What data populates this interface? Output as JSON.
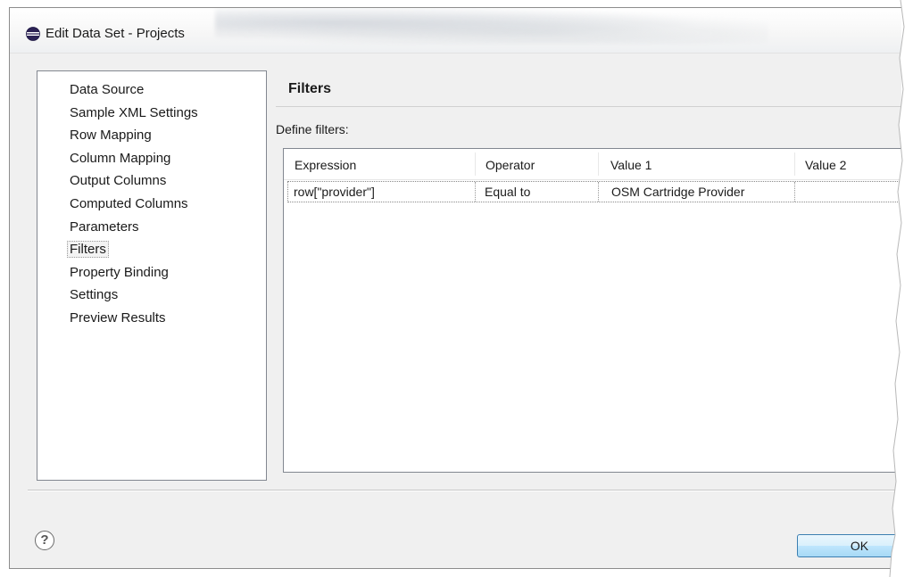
{
  "window": {
    "title": "Edit Data Set - Projects"
  },
  "sidebar": {
    "items": [
      {
        "label": "Data Source"
      },
      {
        "label": "Sample XML Settings"
      },
      {
        "label": "Row Mapping"
      },
      {
        "label": "Column Mapping"
      },
      {
        "label": "Output Columns"
      },
      {
        "label": "Computed Columns"
      },
      {
        "label": "Parameters"
      },
      {
        "label": "Filters",
        "selected": true
      },
      {
        "label": "Property Binding"
      },
      {
        "label": "Settings"
      },
      {
        "label": "Preview Results"
      }
    ]
  },
  "main": {
    "title": "Filters",
    "define_label": "Define filters:",
    "table": {
      "columns": [
        "Expression",
        "Operator",
        "Value 1",
        "Value 2"
      ],
      "rows": [
        [
          "row[\"provider\"]",
          "Equal to",
          "OSM Cartridge Provider",
          ""
        ]
      ]
    }
  },
  "footer": {
    "help_glyph": "?",
    "ok_label": "OK"
  },
  "icons": {
    "title_icon": "eclipse-icon",
    "help_icon": "question-circle-icon"
  },
  "colors": {
    "selection_border": "#9a9a9a",
    "ok_button_border": "#3c7fb1"
  }
}
